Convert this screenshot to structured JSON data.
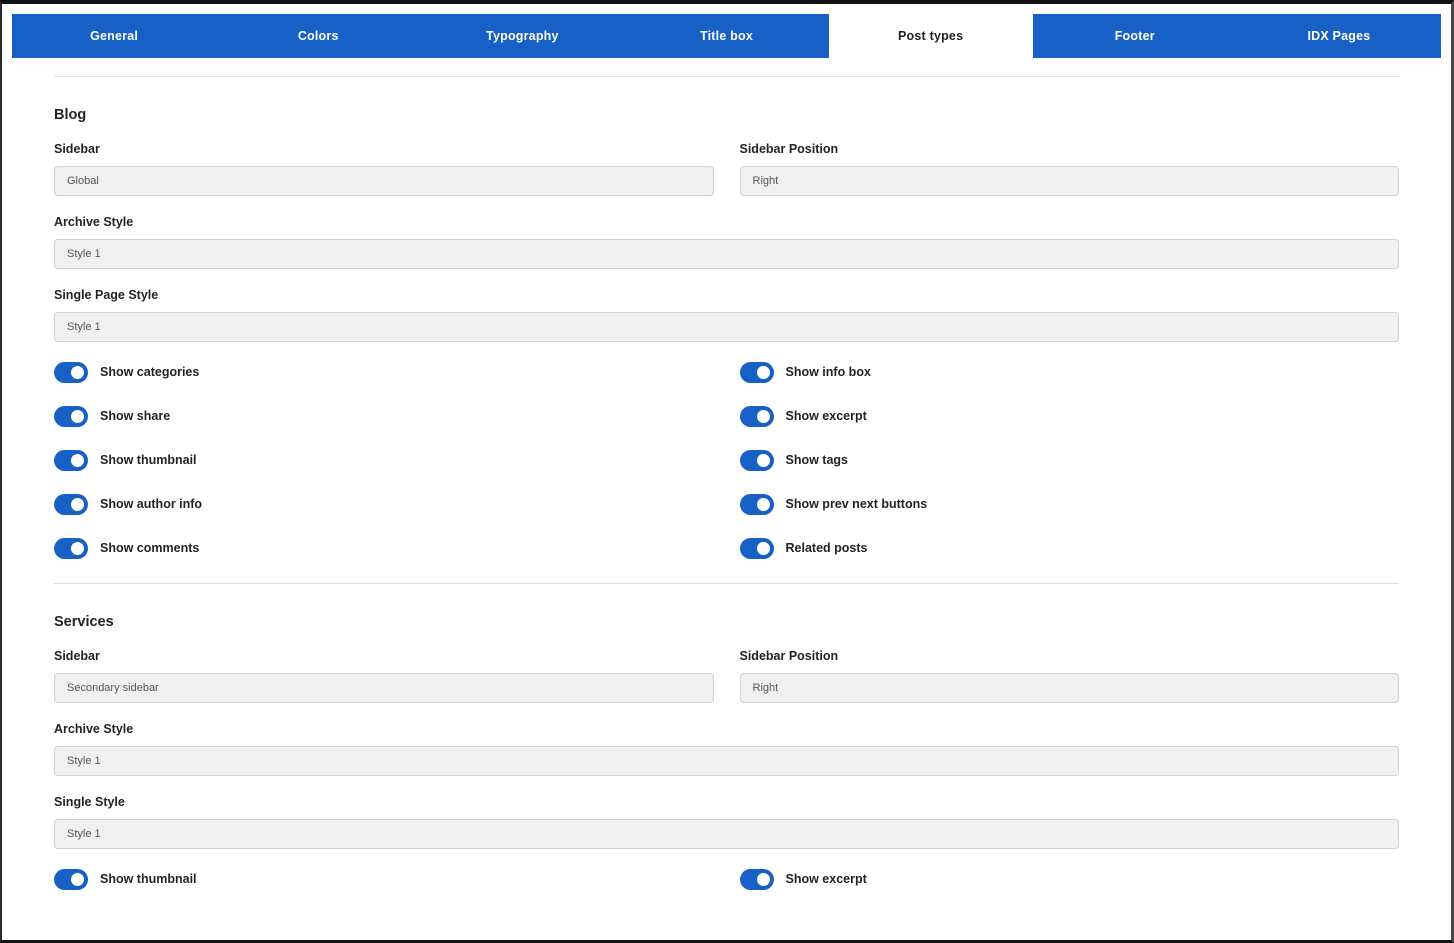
{
  "tabs": [
    {
      "label": "General",
      "active": false
    },
    {
      "label": "Colors",
      "active": false
    },
    {
      "label": "Typography",
      "active": false
    },
    {
      "label": "Title box",
      "active": false
    },
    {
      "label": "Post types",
      "active": true
    },
    {
      "label": "Footer",
      "active": false
    },
    {
      "label": "IDX Pages",
      "active": false
    }
  ],
  "colors": {
    "accent": "#1760C6",
    "input_bg": "#F0F0F1",
    "input_border": "#D0D0D3",
    "divider": "#DCDCDE",
    "label_text": "#1D2327",
    "input_text": "#50575E"
  },
  "sections": [
    {
      "title": "Blog",
      "fields": {
        "sidebar": {
          "label": "Sidebar",
          "value": "Global"
        },
        "sidebar_position": {
          "label": "Sidebar Position",
          "value": "Right"
        },
        "archive_style": {
          "label": "Archive Style",
          "value": "Style 1"
        },
        "single_page_style": {
          "label": "Single Page Style",
          "value": "Style 1"
        }
      },
      "toggles_left": [
        {
          "label": "Show categories",
          "on": true
        },
        {
          "label": "Show share",
          "on": true
        },
        {
          "label": "Show thumbnail",
          "on": true
        },
        {
          "label": "Show author info",
          "on": true
        },
        {
          "label": "Show comments",
          "on": true
        }
      ],
      "toggles_right": [
        {
          "label": "Show info box",
          "on": true
        },
        {
          "label": "Show excerpt",
          "on": true
        },
        {
          "label": "Show tags",
          "on": true
        },
        {
          "label": "Show prev next buttons",
          "on": true
        },
        {
          "label": "Related posts",
          "on": true
        }
      ]
    },
    {
      "title": "Services",
      "fields": {
        "sidebar": {
          "label": "Sidebar",
          "value": "Secondary sidebar"
        },
        "sidebar_position": {
          "label": "Sidebar Position",
          "value": "Right"
        },
        "archive_style": {
          "label": "Archive Style",
          "value": "Style 1"
        },
        "single_style": {
          "label": "Single Style",
          "value": "Style 1"
        }
      },
      "toggles_left": [
        {
          "label": "Show thumbnail",
          "on": true
        }
      ],
      "toggles_right": [
        {
          "label": "Show excerpt",
          "on": true
        }
      ]
    }
  ]
}
